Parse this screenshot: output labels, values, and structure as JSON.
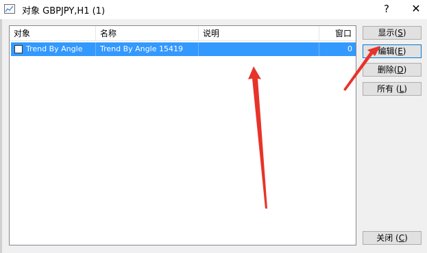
{
  "window": {
    "title": "对象 GBPJPY,H1 (1)",
    "help_label": "?",
    "close_label": "✕"
  },
  "list": {
    "columns": [
      "对象",
      "名称",
      "说明",
      "窗口"
    ],
    "rows": [
      {
        "checked": false,
        "object": "Trend By Angle",
        "name": "Trend By Angle 15419",
        "description": "",
        "window": "0",
        "selected": true
      }
    ]
  },
  "buttons": {
    "show": {
      "label": "显示(",
      "accel": "S",
      "end": ")"
    },
    "edit": {
      "label": "编辑(",
      "accel": "E",
      "end": ")"
    },
    "delete": {
      "label": "删除(",
      "accel": "D",
      "end": ")"
    },
    "all": {
      "label": "所有 (",
      "accel": "L",
      "end": ")"
    },
    "close": {
      "label": "关闭 (",
      "accel": "C",
      "end": ")"
    }
  },
  "colors": {
    "selection": "#3399ff",
    "annotation_arrow": "#e8332a",
    "button_focus": "#0078d7"
  }
}
